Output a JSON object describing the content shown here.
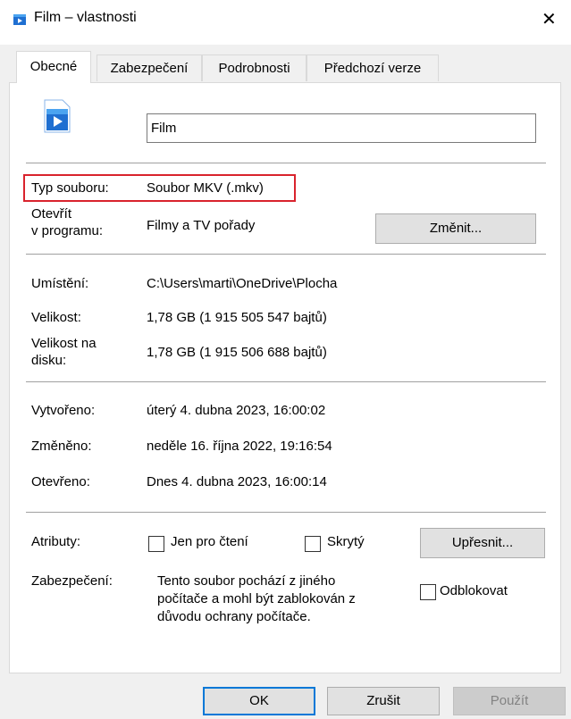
{
  "window": {
    "title": "Film – vlastnosti",
    "close_glyph": "✕",
    "file_icon": "video-file-icon"
  },
  "tabs": [
    {
      "label": "Obecné",
      "active": true
    },
    {
      "label": "Zabezpečení",
      "active": false
    },
    {
      "label": "Podrobnosti",
      "active": false
    },
    {
      "label": "Předchozí verze",
      "active": false
    }
  ],
  "general": {
    "name_value": "Film",
    "file_type_label": "Typ souboru:",
    "file_type_value": "Soubor MKV (.mkv)",
    "opens_with_label_1": "Otevřít",
    "opens_with_label_2": "v programu:",
    "opens_with_value": "Filmy a TV pořady",
    "change_button": "Změnit...",
    "location_label": "Umístění:",
    "location_value": "C:\\Users\\marti\\OneDrive\\Plocha",
    "size_label": "Velikost:",
    "size_value": "1,78 GB (1 915 505 547 bajtů)",
    "size_on_disk_label_1": "Velikost na",
    "size_on_disk_label_2": "disku:",
    "size_on_disk_value": "1,78 GB (1 915 506 688 bajtů)",
    "created_label": "Vytvořeno:",
    "created_value": "úterý 4. dubna 2023, 16:00:02",
    "modified_label": "Změněno:",
    "modified_value": "neděle 16. října 2022, 19:16:54",
    "accessed_label": "Otevřeno:",
    "accessed_value": "Dnes 4. dubna 2023, 16:00:14",
    "attributes_label": "Atributy:",
    "readonly_label": "Jen pro čtení",
    "hidden_label": "Skrytý",
    "advanced_button": "Upřesnit...",
    "security_label": "Zabezpečení:",
    "security_text_1": "Tento soubor pochází z jiného",
    "security_text_2": "počítače a mohl být zablokován z",
    "security_text_3": "důvodu ochrany počítače.",
    "unblock_label": "Odblokovat"
  },
  "buttons": {
    "ok": "OK",
    "cancel": "Zrušit",
    "apply": "Použít"
  },
  "colors": {
    "highlight": "#d9232d",
    "accent": "#0078d7",
    "icon_blue": "#1f6fd1"
  }
}
